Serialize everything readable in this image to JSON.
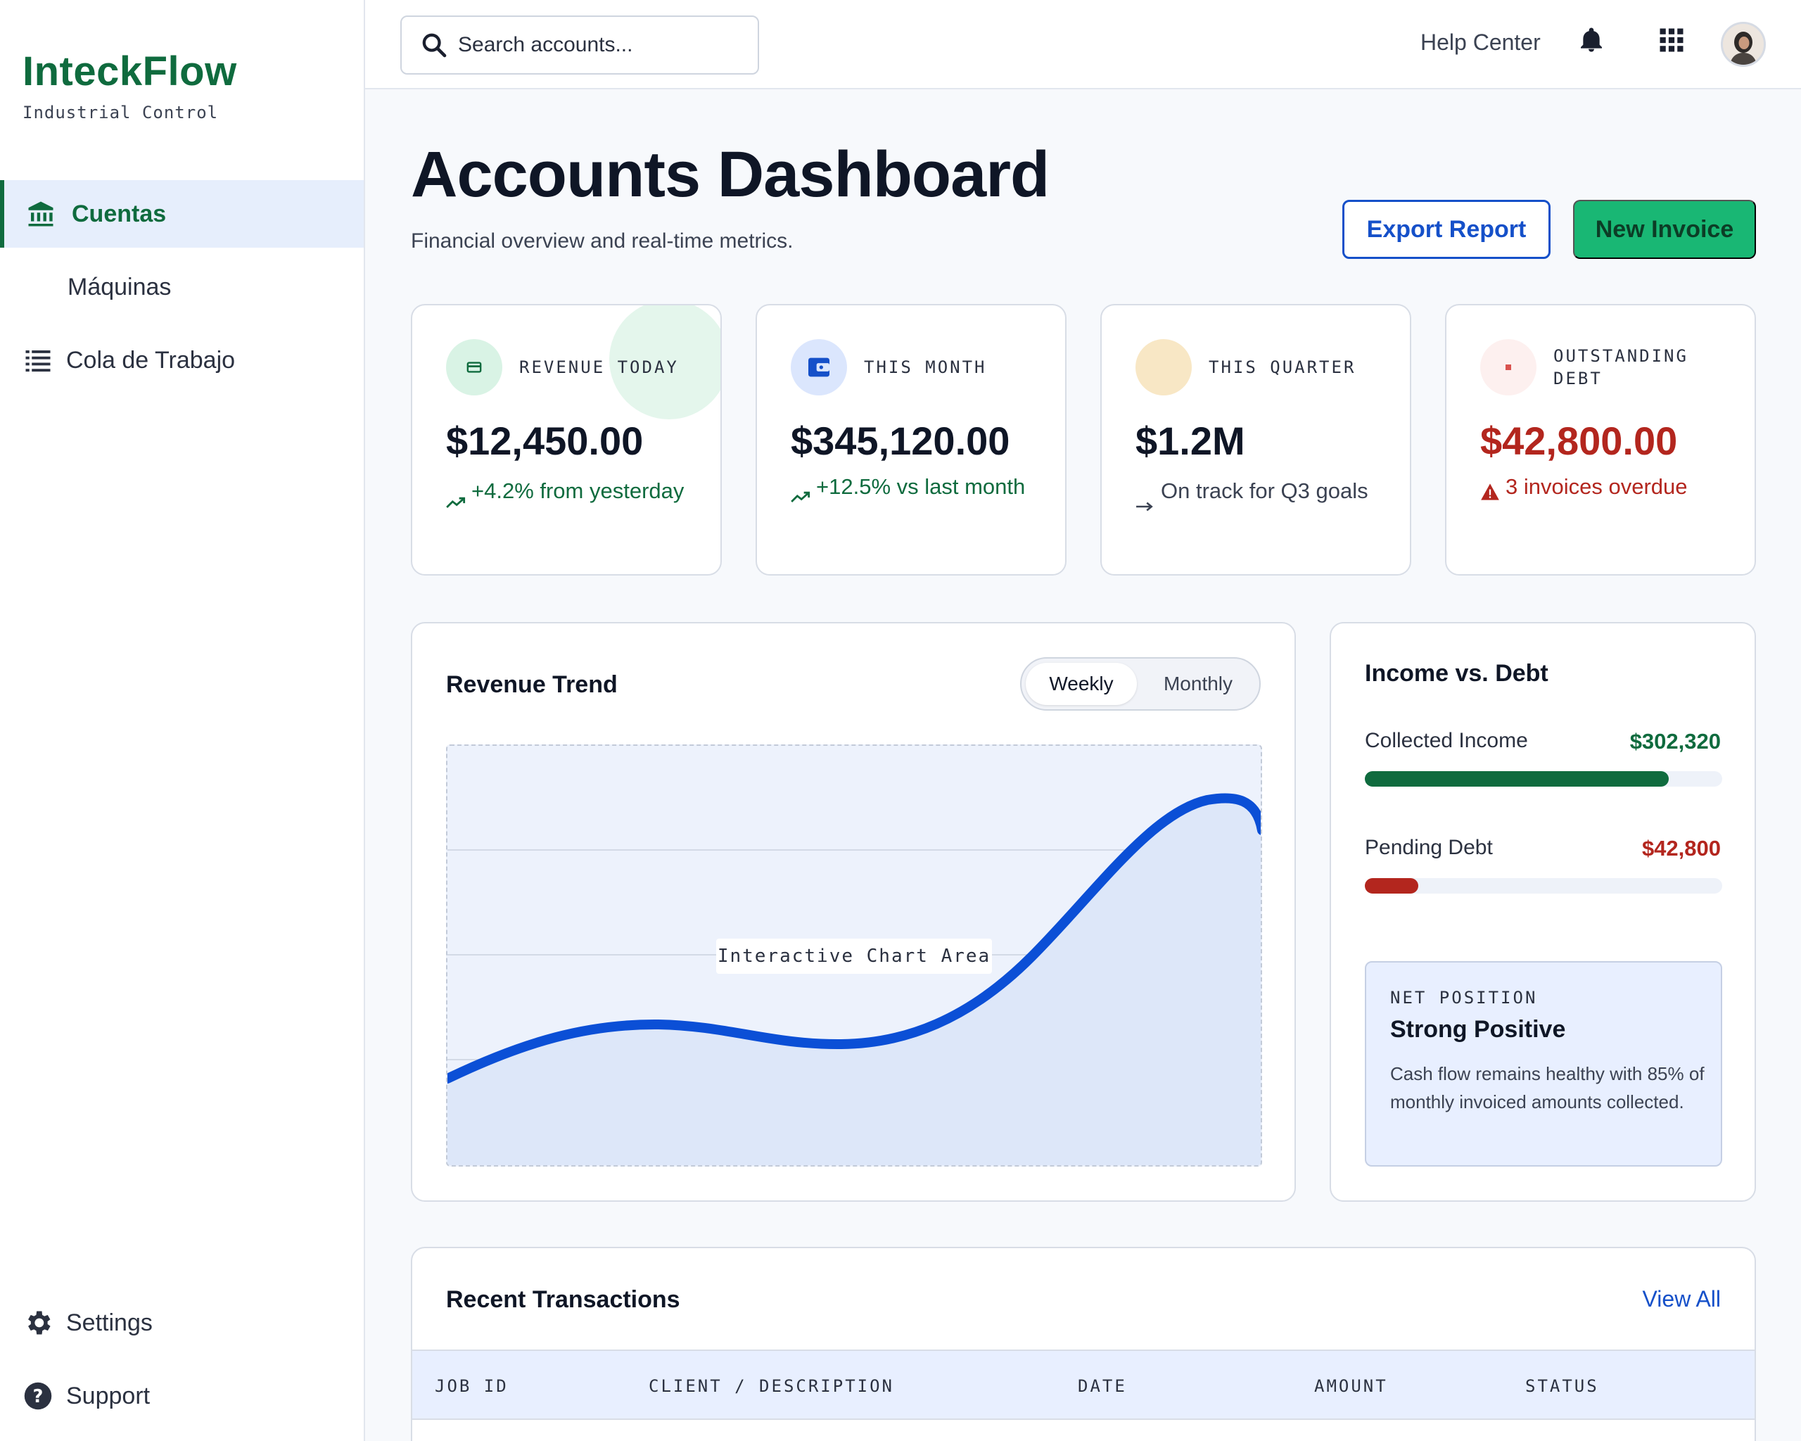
{
  "brand": {
    "name": "InteckFlow",
    "subtitle": "Industrial Control"
  },
  "sidebar": {
    "items": [
      {
        "label": "Cuentas",
        "icon": "bank-icon",
        "active": true
      },
      {
        "label": "Máquinas",
        "icon": "",
        "active": false
      },
      {
        "label": "Cola de Trabajo",
        "icon": "list-icon",
        "active": false
      }
    ],
    "bottom": [
      {
        "label": "Settings",
        "icon": "gear-icon"
      },
      {
        "label": "Support",
        "icon": "help-icon"
      }
    ]
  },
  "topbar": {
    "search_placeholder": "Search accounts...",
    "help_label": "Help Center",
    "icons": [
      "bell-icon",
      "apps-grid-icon",
      "user-avatar"
    ]
  },
  "header": {
    "title": "Accounts Dashboard",
    "subtitle": "Financial overview and real-time metrics.",
    "export_label": "Export Report",
    "new_invoice_label": "New Invoice"
  },
  "kpis": [
    {
      "label": "REVENUE TODAY",
      "value": "$12,450.00",
      "trend": "+4.2% from yesterday",
      "trend_color": "#0f6b3e",
      "icon": "credit-card-icon",
      "value_color": "#0f1626"
    },
    {
      "label": "THIS MONTH",
      "value": "$345,120.00",
      "trend": "+12.5% vs last month",
      "trend_color": "#0f6b3e",
      "icon": "wallet-icon",
      "value_color": "#0f1626"
    },
    {
      "label": "THIS QUARTER",
      "value": "$1.2M",
      "trend": "On track for Q3 goals",
      "trend_color": "#3b4252",
      "icon": "calendar-icon",
      "value_color": "#0f1626"
    },
    {
      "label": "OUTSTANDING DEBT",
      "value": "$42,800.00",
      "trend": "3 invoices overdue",
      "trend_color": "#b3261e",
      "icon": "alert-dot-icon",
      "value_color": "#b3261e"
    }
  ],
  "revenue_trend": {
    "title": "Revenue Trend",
    "toggle": [
      "Weekly",
      "Monthly"
    ],
    "selected": "Weekly",
    "chart_placeholder": "Interactive Chart Area"
  },
  "income_debt": {
    "title": "Income vs. Debt",
    "rows": [
      {
        "label": "Collected Income",
        "value": "$302,320",
        "fill": 0.85,
        "color": "#0f6b3e"
      },
      {
        "label": "Pending Debt",
        "value": "$42,800",
        "fill": 0.15,
        "color": "#b3261e"
      }
    ],
    "net": {
      "label": "NET POSITION",
      "title": "Strong Positive",
      "description": "Cash flow remains healthy with 85% of monthly invoiced amounts collected."
    }
  },
  "transactions": {
    "title": "Recent Transactions",
    "view_all": "View All",
    "columns": [
      "JOB ID",
      "CLIENT / DESCRIPTION",
      "DATE",
      "AMOUNT",
      "STATUS"
    ]
  },
  "colors": {
    "brand_green": "#0f6b3e",
    "accent_blue": "#1550c9",
    "cta_green": "#19b774",
    "danger": "#b3261e"
  }
}
